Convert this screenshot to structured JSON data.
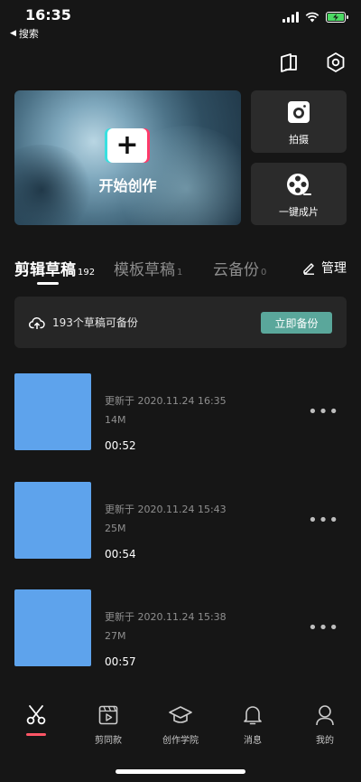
{
  "status_bar": {
    "time": "16:35",
    "back_label": "搜索"
  },
  "top_actions": {
    "icons": [
      "book-icon",
      "settings-icon"
    ]
  },
  "create": {
    "start_label": "开始创作",
    "shoot_label": "拍摄",
    "oneclick_label": "一键成片"
  },
  "tabs": [
    {
      "label": "剪辑草稿",
      "count": "192"
    },
    {
      "label": "模板草稿",
      "count": "1"
    },
    {
      "label": "云备份",
      "count": "0"
    }
  ],
  "manage_label": "管理",
  "backup": {
    "text": "193个草稿可备份",
    "button": "立即备份"
  },
  "drafts": [
    {
      "updated": "更新于 2020.11.24 16:35",
      "size": "14M",
      "duration": "00:52"
    },
    {
      "updated": "更新于 2020.11.24 15:43",
      "size": "25M",
      "duration": "00:54"
    },
    {
      "updated": "更新于 2020.11.24 15:38",
      "size": "27M",
      "duration": "00:57"
    }
  ],
  "bottom_nav": [
    {
      "label": ""
    },
    {
      "label": "剪同款"
    },
    {
      "label": "创作学院"
    },
    {
      "label": "消息"
    },
    {
      "label": "我的"
    }
  ],
  "colors": {
    "background": "#161616",
    "card": "#2b2b2b",
    "accent_teal": "#5aa79b",
    "thumb_blue": "#5ea3ec",
    "active_red": "#ff5566"
  }
}
